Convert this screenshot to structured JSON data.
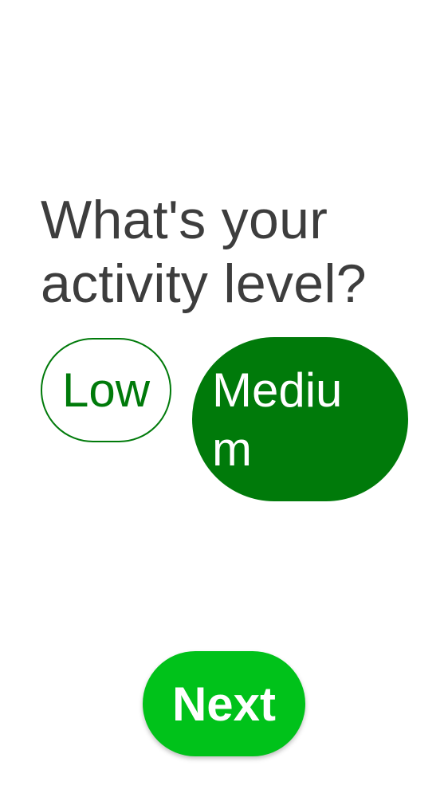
{
  "question": {
    "title": "What's your activity level?"
  },
  "options": [
    {
      "label": "Low",
      "selected": false
    },
    {
      "label": "Medium",
      "selected": true
    }
  ],
  "actions": {
    "next_label": "Next"
  },
  "colors": {
    "selected_fill": "#007a0a",
    "unselected_outline": "#007a0a",
    "next_button": "#00c21a",
    "title_text": "#3d3d3d"
  }
}
